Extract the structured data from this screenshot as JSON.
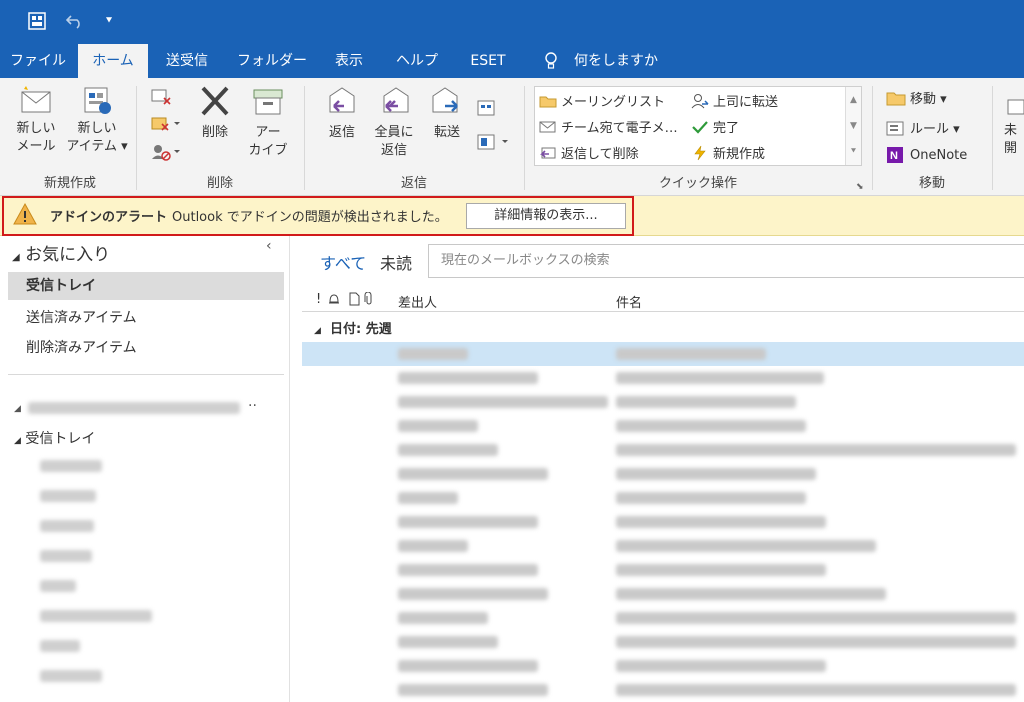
{
  "tabs": [
    "ファイル",
    "ホーム",
    "送受信",
    "フォルダー",
    "表示",
    "ヘルプ",
    "ESET",
    "何をしますか"
  ],
  "ribbon": {
    "new": {
      "new_mail": [
        "新しい",
        "メール"
      ],
      "new_items": [
        "新しい",
        "アイテム ▾"
      ],
      "group": "新規作成"
    },
    "delete": {
      "delete_label": "削除",
      "archive": [
        "アー",
        "カイブ"
      ],
      "group": "削除"
    },
    "respond": {
      "reply": "返信",
      "reply_all": [
        "全員に",
        "返信"
      ],
      "forward": "転送",
      "group": "返信"
    },
    "quicksteps": {
      "items": [
        "メーリングリスト",
        "チーム宛て電子メ…",
        "返信して削除",
        "上司に転送",
        "完了",
        "新規作成"
      ],
      "group": "クイック操作"
    },
    "move": {
      "move": "移動 ▾",
      "rules": "ルール ▾",
      "onenote": "OneNote",
      "group": "移動"
    },
    "more": [
      "未",
      "開"
    ]
  },
  "alert": {
    "title": "アドインのアラート",
    "message": "Outlook でアドインの問題が検出されました。",
    "button": "詳細情報の表示..."
  },
  "nav": {
    "favorites": "お気に入り",
    "fav_items": [
      "受信トレイ",
      "送信済みアイテム",
      "削除済みアイテム"
    ],
    "inbox": "受信トレイ"
  },
  "list": {
    "filter_all": "すべて",
    "filter_unread": "未読",
    "search_placeholder": "現在のメールボックスの検索",
    "col_from": "差出人",
    "col_subject": "件名",
    "group_header": "日付: 先週"
  },
  "colors": {
    "accent": "#1a62b6",
    "alert_border": "#d11a1a",
    "alert_bg": "#fdf4c9"
  }
}
